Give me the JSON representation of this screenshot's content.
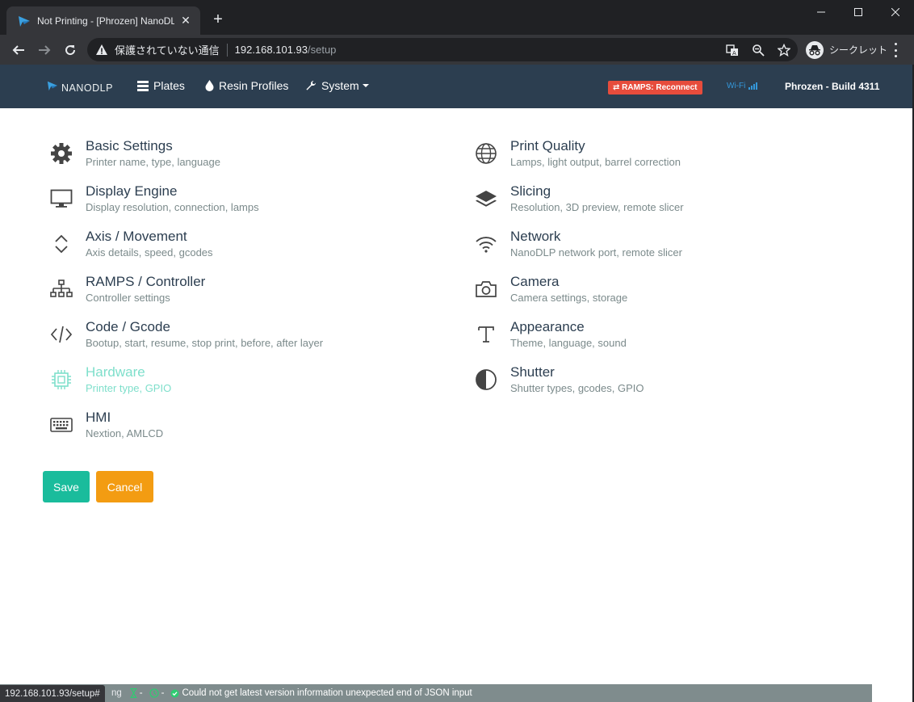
{
  "browser": {
    "tab_title": "Not Printing - [Phrozen] NanoDLP",
    "security_text": "保護されていない通信",
    "url_host": "192.168.101.93",
    "url_path": "/setup",
    "incognito_label": "シークレット",
    "hover_url": "192.168.101.93/setup#"
  },
  "navbar": {
    "brand": "NANODLP",
    "links": [
      {
        "label": "Plates",
        "icon": "list-icon"
      },
      {
        "label": "Resin Profiles",
        "icon": "drop-icon"
      },
      {
        "label": "System",
        "icon": "wrench-icon"
      }
    ],
    "ramps_status": "⇄ RAMPS: Reconnect",
    "wifi_label": "Wi-Fi",
    "build": "Phrozen - Build 4311"
  },
  "settings_left": [
    {
      "title": "Basic Settings",
      "desc": "Printer name, type, language",
      "icon": "gear-icon"
    },
    {
      "title": "Display Engine",
      "desc": "Display resolution, connection, lamps",
      "icon": "monitor-icon"
    },
    {
      "title": "Axis / Movement",
      "desc": "Axis details, speed, gcodes",
      "icon": "up-down-icon"
    },
    {
      "title": "RAMPS / Controller",
      "desc": "Controller settings",
      "icon": "network-tree-icon"
    },
    {
      "title": "Code / Gcode",
      "desc": "Bootup, start, resume, stop print, before, after layer",
      "icon": "code-icon"
    },
    {
      "title": "Hardware",
      "desc": "Printer type, GPIO",
      "icon": "chip-icon"
    },
    {
      "title": "HMI",
      "desc": "Nextion, AMLCD",
      "icon": "keyboard-icon"
    }
  ],
  "settings_right": [
    {
      "title": "Print Quality",
      "desc": "Lamps, light output, barrel correction",
      "icon": "globe-icon"
    },
    {
      "title": "Slicing",
      "desc": "Resolution, 3D preview, remote slicer",
      "icon": "layers-icon"
    },
    {
      "title": "Network",
      "desc": "NanoDLP network port, remote slicer",
      "icon": "wifi-icon"
    },
    {
      "title": "Camera",
      "desc": "Camera settings, storage",
      "icon": "camera-icon"
    },
    {
      "title": "Appearance",
      "desc": "Theme, language, sound",
      "icon": "text-icon"
    },
    {
      "title": "Shutter",
      "desc": "Shutter types, gcodes, GPIO",
      "icon": "half-circle-icon"
    }
  ],
  "buttons": {
    "save": "Save",
    "cancel": "Cancel"
  },
  "status": {
    "fragment": "ng",
    "seg1": "-",
    "seg2": "-",
    "message": "Could not get latest version information unexpected end of JSON input"
  }
}
